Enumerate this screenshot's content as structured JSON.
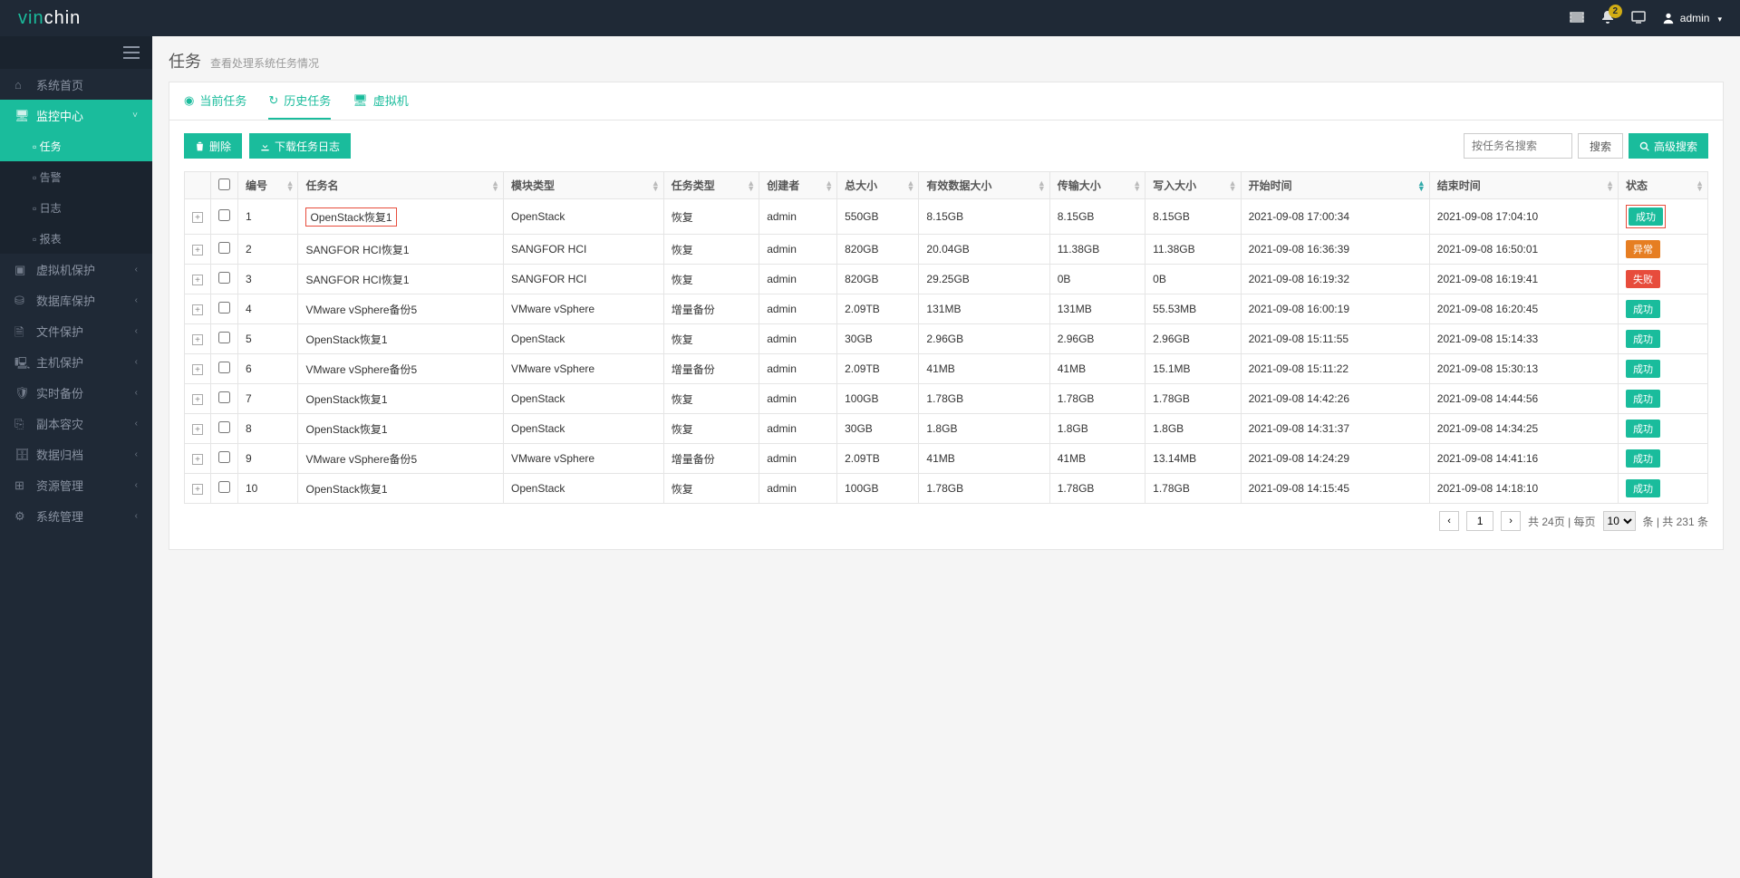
{
  "app": {
    "logo_prefix": "vin",
    "logo_suffix": "chin"
  },
  "topbar": {
    "notify_count": "2",
    "username": "admin"
  },
  "sidebar": {
    "items": [
      {
        "label": "系统首页",
        "expandable": false
      },
      {
        "label": "监控中心",
        "active": true,
        "expandable": true,
        "open": true,
        "sub": [
          {
            "label": "任务",
            "active": true
          },
          {
            "label": "告警"
          },
          {
            "label": "日志"
          },
          {
            "label": "报表"
          }
        ]
      },
      {
        "label": "虚拟机保护",
        "expandable": true
      },
      {
        "label": "数据库保护",
        "expandable": true
      },
      {
        "label": "文件保护",
        "expandable": true
      },
      {
        "label": "主机保护",
        "expandable": true
      },
      {
        "label": "实时备份",
        "expandable": true
      },
      {
        "label": "副本容灾",
        "expandable": true
      },
      {
        "label": "数据归档",
        "expandable": true
      },
      {
        "label": "资源管理",
        "expandable": true
      },
      {
        "label": "系统管理",
        "expandable": true
      }
    ]
  },
  "page": {
    "title": "任务",
    "subtitle": "查看处理系统任务情况"
  },
  "tabs": [
    {
      "label": "当前任务"
    },
    {
      "label": "历史任务",
      "active": true
    },
    {
      "label": "虚拟机"
    }
  ],
  "toolbar": {
    "delete_label": "删除",
    "download_log_label": "下载任务日志",
    "search_placeholder": "按任务名搜索",
    "search_btn": "搜索",
    "adv_search_btn": "高级搜索"
  },
  "table": {
    "headers": [
      "编号",
      "任务名",
      "模块类型",
      "任务类型",
      "创建者",
      "总大小",
      "有效数据大小",
      "传输大小",
      "写入大小",
      "开始时间",
      "结束时间",
      "状态"
    ],
    "sort_col": 9,
    "rows": [
      {
        "no": "1",
        "name": "OpenStack恢复1",
        "module": "OpenStack",
        "type": "恢复",
        "creator": "admin",
        "total": "550GB",
        "valid": "8.15GB",
        "transfer": "8.15GB",
        "write": "8.15GB",
        "start": "2021-09-08 17:00:34",
        "end": "2021-09-08 17:04:10",
        "status": "成功",
        "status_cls": "success",
        "highlight": true,
        "status_hl": true
      },
      {
        "no": "2",
        "name": "SANGFOR HCI恢复1",
        "module": "SANGFOR HCI",
        "type": "恢复",
        "creator": "admin",
        "total": "820GB",
        "valid": "20.04GB",
        "transfer": "11.38GB",
        "write": "11.38GB",
        "start": "2021-09-08 16:36:39",
        "end": "2021-09-08 16:50:01",
        "status": "异常",
        "status_cls": "error"
      },
      {
        "no": "3",
        "name": "SANGFOR HCI恢复1",
        "module": "SANGFOR HCI",
        "type": "恢复",
        "creator": "admin",
        "total": "820GB",
        "valid": "29.25GB",
        "transfer": "0B",
        "write": "0B",
        "start": "2021-09-08 16:19:32",
        "end": "2021-09-08 16:19:41",
        "status": "失败",
        "status_cls": "fail"
      },
      {
        "no": "4",
        "name": "VMware vSphere备份5",
        "module": "VMware vSphere",
        "type": "增量备份",
        "creator": "admin",
        "total": "2.09TB",
        "valid": "131MB",
        "transfer": "131MB",
        "write": "55.53MB",
        "start": "2021-09-08 16:00:19",
        "end": "2021-09-08 16:20:45",
        "status": "成功",
        "status_cls": "success"
      },
      {
        "no": "5",
        "name": "OpenStack恢复1",
        "module": "OpenStack",
        "type": "恢复",
        "creator": "admin",
        "total": "30GB",
        "valid": "2.96GB",
        "transfer": "2.96GB",
        "write": "2.96GB",
        "start": "2021-09-08 15:11:55",
        "end": "2021-09-08 15:14:33",
        "status": "成功",
        "status_cls": "success"
      },
      {
        "no": "6",
        "name": "VMware vSphere备份5",
        "module": "VMware vSphere",
        "type": "增量备份",
        "creator": "admin",
        "total": "2.09TB",
        "valid": "41MB",
        "transfer": "41MB",
        "write": "15.1MB",
        "start": "2021-09-08 15:11:22",
        "end": "2021-09-08 15:30:13",
        "status": "成功",
        "status_cls": "success"
      },
      {
        "no": "7",
        "name": "OpenStack恢复1",
        "module": "OpenStack",
        "type": "恢复",
        "creator": "admin",
        "total": "100GB",
        "valid": "1.78GB",
        "transfer": "1.78GB",
        "write": "1.78GB",
        "start": "2021-09-08 14:42:26",
        "end": "2021-09-08 14:44:56",
        "status": "成功",
        "status_cls": "success"
      },
      {
        "no": "8",
        "name": "OpenStack恢复1",
        "module": "OpenStack",
        "type": "恢复",
        "creator": "admin",
        "total": "30GB",
        "valid": "1.8GB",
        "transfer": "1.8GB",
        "write": "1.8GB",
        "start": "2021-09-08 14:31:37",
        "end": "2021-09-08 14:34:25",
        "status": "成功",
        "status_cls": "success"
      },
      {
        "no": "9",
        "name": "VMware vSphere备份5",
        "module": "VMware vSphere",
        "type": "增量备份",
        "creator": "admin",
        "total": "2.09TB",
        "valid": "41MB",
        "transfer": "41MB",
        "write": "13.14MB",
        "start": "2021-09-08 14:24:29",
        "end": "2021-09-08 14:41:16",
        "status": "成功",
        "status_cls": "success"
      },
      {
        "no": "10",
        "name": "OpenStack恢复1",
        "module": "OpenStack",
        "type": "恢复",
        "creator": "admin",
        "total": "100GB",
        "valid": "1.78GB",
        "transfer": "1.78GB",
        "write": "1.78GB",
        "start": "2021-09-08 14:15:45",
        "end": "2021-09-08 14:18:10",
        "status": "成功",
        "status_cls": "success"
      }
    ]
  },
  "pagination": {
    "current": "1",
    "total_pages_label": "共 24页 | 每页",
    "page_size": "10",
    "total_rows_label": "条 | 共 231 条"
  }
}
